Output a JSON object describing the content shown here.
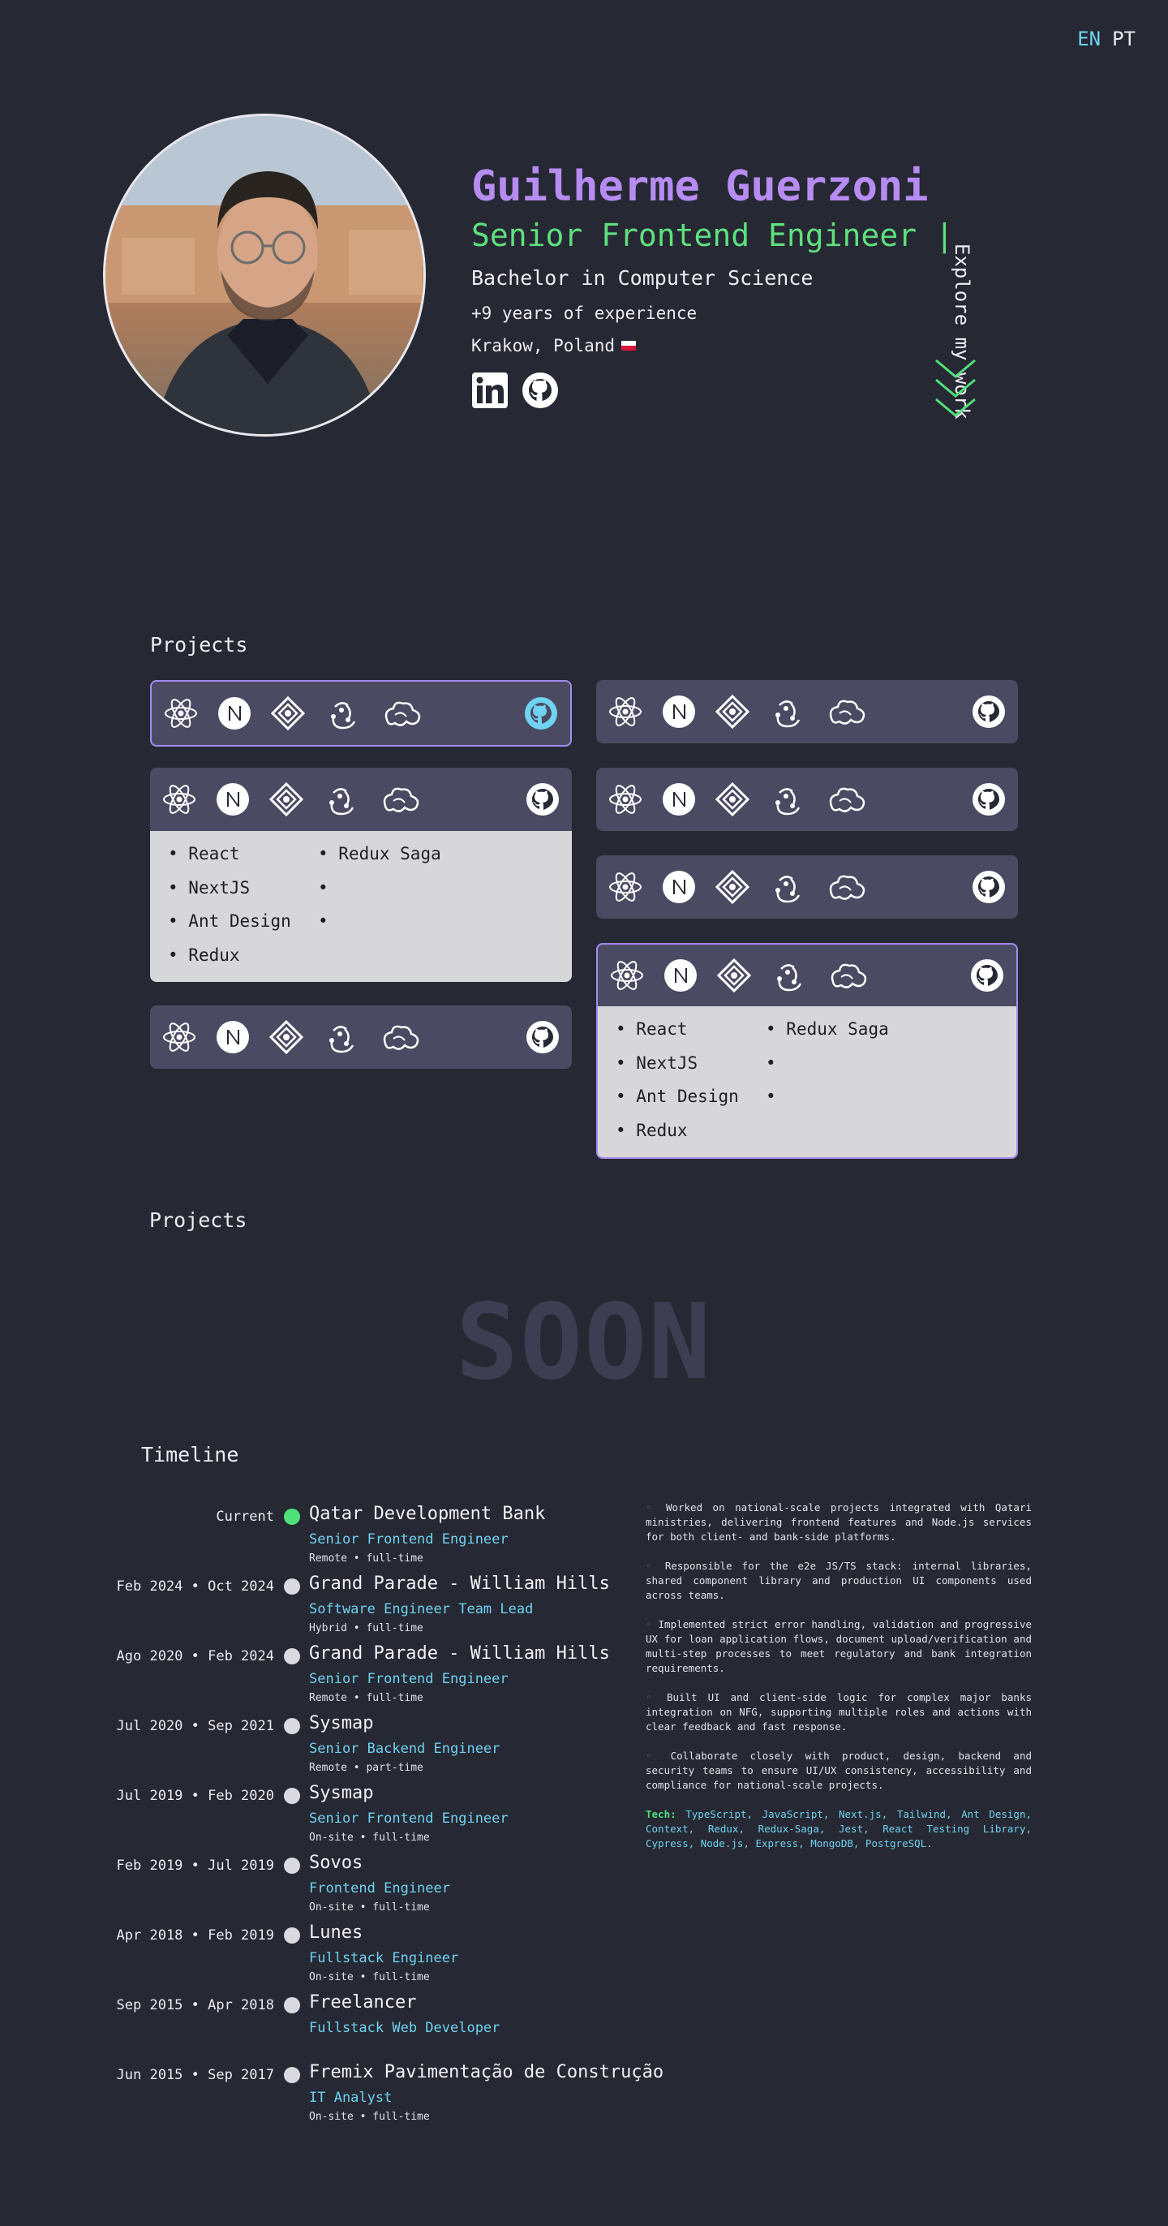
{
  "lang": {
    "en": "EN",
    "pt": "PT"
  },
  "hero": {
    "name": "Guilherme Guerzoni",
    "role": "Senior Frontend Engineer |",
    "degree": "Bachelor in Computer Science",
    "experience": "+9 years of experience",
    "location": "Krakow, Poland",
    "explore": "Explore my work"
  },
  "projects_title": "Projects",
  "project_cards": {
    "stack": [
      "React",
      "NextJS",
      "Ant Design",
      "Redux",
      "Redux Saga"
    ]
  },
  "projects2_title": "Projects",
  "soon": "SOON",
  "timeline": {
    "title": "Timeline",
    "items": [
      {
        "date": "Current",
        "company": "Qatar Development Bank",
        "position": "Senior Frontend Engineer",
        "mode": "Remote • full-time"
      },
      {
        "date": "Feb 2024 • Oct 2024",
        "company": "Grand Parade - William Hills",
        "position": "Software Engineer Team Lead",
        "mode": "Hybrid • full-time"
      },
      {
        "date": "Ago 2020 • Feb 2024",
        "company": "Grand Parade - William Hills",
        "position": "Senior Frontend Engineer",
        "mode": "Remote • full-time"
      },
      {
        "date": "Jul 2020 • Sep 2021",
        "company": "Sysmap",
        "position": "Senior Backend Engineer",
        "mode": "Remote • part-time"
      },
      {
        "date": "Jul 2019 • Feb 2020",
        "company": "Sysmap",
        "position": "Senior Frontend Engineer",
        "mode": "On-site • full-time"
      },
      {
        "date": "Feb 2019 • Jul 2019",
        "company": "Sovos",
        "position": "Frontend Engineer",
        "mode": "On-site • full-time"
      },
      {
        "date": "Apr 2018 • Feb 2019",
        "company": "Lunes",
        "position": "Fullstack Engineer",
        "mode": "On-site • full-time"
      },
      {
        "date": "Sep 2015 • Apr 2018",
        "company": "Freelancer",
        "position": "Fullstack Web Developer",
        "mode": ""
      },
      {
        "date": "Jun 2015 • Sep 2017",
        "company": "Fremix Pavimentação de Construção",
        "position": "IT Analyst",
        "mode": "On-site • full-time"
      }
    ],
    "details": [
      "Worked on national-scale projects integrated with Qatari ministries, delivering frontend features and Node.js services for both client- and bank-side platforms.",
      "Responsible for the e2e JS/TS stack: internal libraries, shared component library and production UI components used across teams.",
      "Implemented strict error handling, validation and progressive UX for loan application flows, document upload/verification and multi-step processes to meet regulatory and bank integration requirements.",
      "Built UI and client-side logic for complex major banks integration on NFG, supporting multiple roles and actions with clear feedback and fast response.",
      "Collaborate closely with product, design, backend and security teams to ensure UI/UX consistency, accessibility and compliance for national-scale projects."
    ],
    "tech_label": "Tech:",
    "tech": "TypeScript, JavaScript, Next.js, Tailwind, Ant Design, Context, Redux, Redux-Saga, Jest, React Testing Library, Cypress, Node.js, Express, MongoDB, PostgreSQL."
  }
}
